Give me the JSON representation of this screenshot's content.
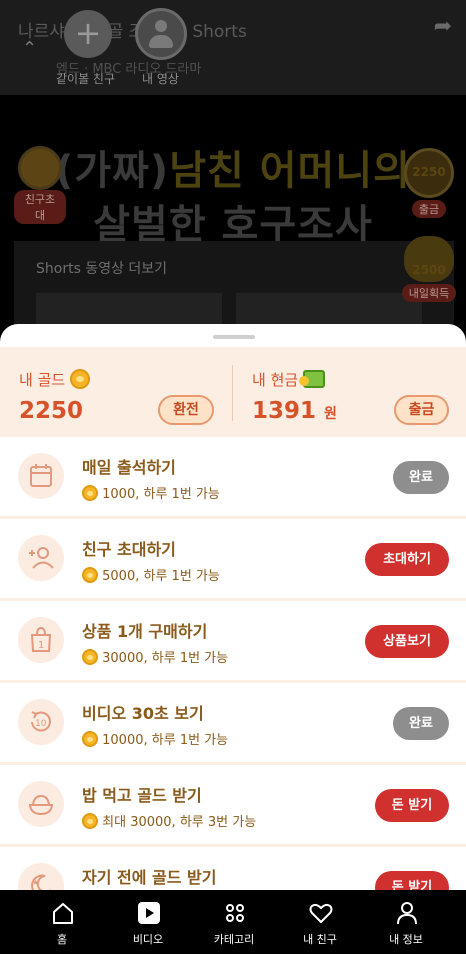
{
  "background": {
    "title": "나르샤 임... 골 조 구 ... Shorts",
    "subtitle": "엠드 · MBC 라디오 드라마",
    "fab_friends_label": "같이볼 친구",
    "fab_me_label": "내 영상",
    "headline_line1_a": "(가짜)",
    "headline_line1_b": "남친 어머니의",
    "headline_line2": "살벌한 호구조사",
    "shorts_more": "Shorts 동영상 더보기",
    "badge_invite": "친구초대",
    "badge_gold_value": "2250",
    "badge_withdraw": "출금",
    "badge_tomorrow_value": "2500",
    "badge_tomorrow": "내일획득"
  },
  "wallet": {
    "gold_label": "내 골드",
    "gold_value": "2250",
    "exchange_button": "환전",
    "cash_label": "내 현금",
    "cash_value": "1391",
    "cash_unit": "원",
    "withdraw_button": "출금"
  },
  "tasks": [
    {
      "title": "매일 출석하기",
      "reward": "1000, 하루 1번 가능",
      "button": "완료",
      "state": "done",
      "icon": "calendar-icon"
    },
    {
      "title": "친구 초대하기",
      "reward": "5000, 하루 1번 가능",
      "button": "초대하기",
      "state": "active",
      "icon": "add-user-icon"
    },
    {
      "title": "상품 1개 구매하기",
      "reward": "30000, 하루 1번 가능",
      "button": "상품보기",
      "state": "active",
      "icon": "shopping-bag-icon"
    },
    {
      "title": "비디오 30초 보기",
      "reward": "10000, 하루 1번 가능",
      "button": "완료",
      "state": "done",
      "icon": "replay-10-icon"
    },
    {
      "title": "밥 먹고 골드 받기",
      "reward": "최대 30000, 하루 3번 가능",
      "button": "돈 받기",
      "state": "active",
      "icon": "rice-bowl-icon"
    },
    {
      "title": "자기 전에 골드 받기",
      "reward": "",
      "button": "돈 받기",
      "state": "active",
      "icon": "moon-icon"
    }
  ],
  "nav": [
    {
      "label": "홈",
      "icon": "home-icon"
    },
    {
      "label": "비디오",
      "icon": "video-icon"
    },
    {
      "label": "카테고리",
      "icon": "category-icon"
    },
    {
      "label": "내 친구",
      "icon": "heart-icon"
    },
    {
      "label": "내 정보",
      "icon": "person-icon"
    }
  ],
  "colors": {
    "accent": "#d0302e",
    "gold_text": "#d6532a",
    "task_text": "#8a5a1a",
    "done_button": "#8e8e8e",
    "wallet_bg": "#fdeee3"
  }
}
